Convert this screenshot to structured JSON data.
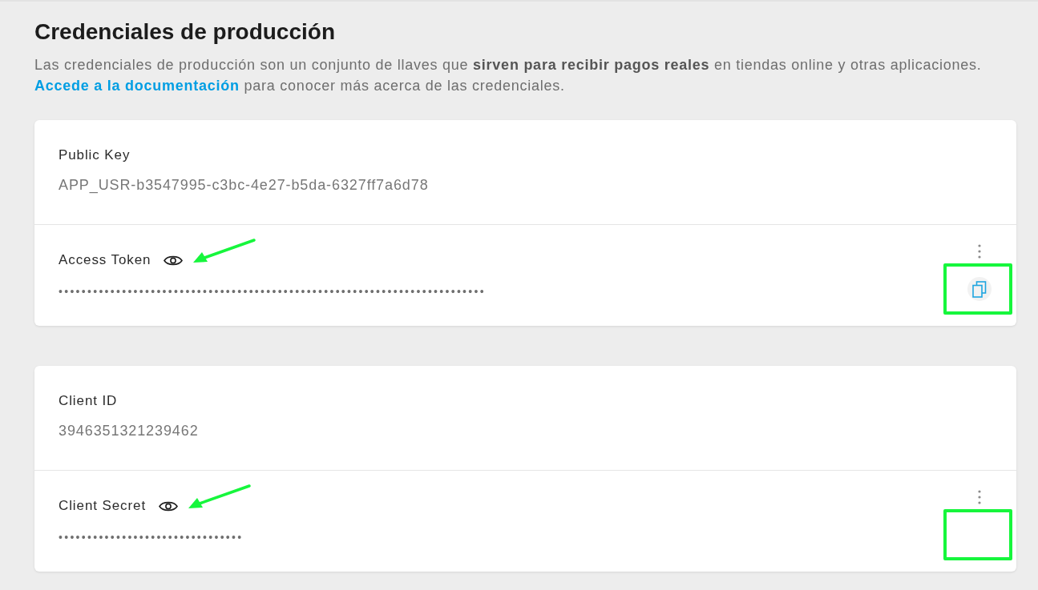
{
  "page": {
    "title": "Credenciales de producción",
    "description": "Las credenciales de producción son un conjunto de llaves que **sirven para recibir pagos reales** en tiendas online y otras aplicaciones.",
    "documentation_link": "Accede a la documentación",
    "description_after_link": "para conocer más acerca de las credenciales."
  },
  "cards": [
    {
      "fields": [
        {
          "kind": "plain",
          "label": "Public Key",
          "value": "APP_USR-b3547995-c3bc-4e27-b5da-6327ff7a6d78"
        },
        {
          "kind": "secret",
          "label": "Access Token",
          "value": "••••••••••••••••••••••••••••••••••••••••••••••••••••••••••••••••••••••••••",
          "copy_button": true,
          "arrow_marked": true,
          "box_marked": true
        }
      ]
    },
    {
      "fields": [
        {
          "kind": "plain",
          "label": "Client ID",
          "value": "3946351321239462"
        },
        {
          "kind": "secret",
          "label": "Client Secret",
          "value": "••••••••••••••••••••••••••••••••",
          "copy_button": false,
          "arrow_marked": true,
          "box_marked": true
        }
      ]
    }
  ]
}
